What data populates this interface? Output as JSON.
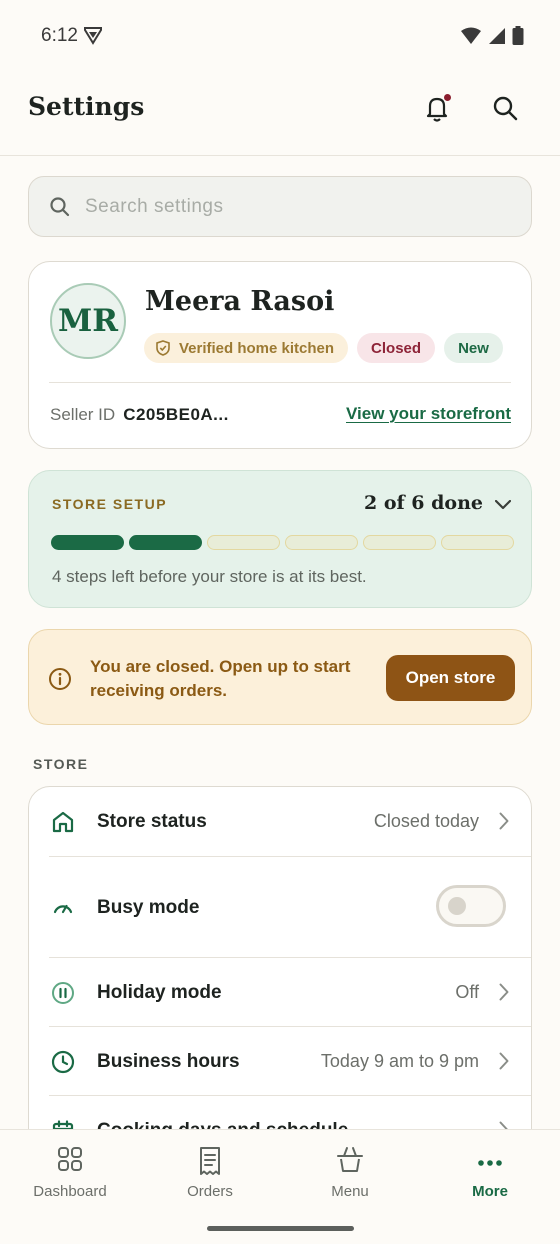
{
  "status_bar": {
    "time": "6:12"
  },
  "app_bar": {
    "title": "Settings"
  },
  "search": {
    "placeholder": "Search settings",
    "value": ""
  },
  "profile": {
    "initials": "MR",
    "name": "Meera Rasoi",
    "badges": [
      "Verified home kitchen",
      "Closed",
      "New"
    ],
    "seller_id_label": "Seller ID",
    "seller_id_value": "C205BE0A...",
    "storefront_link": "View your storefront"
  },
  "setup": {
    "label": "STORE SETUP",
    "progress_text": "2 of 6 done",
    "steps_done": 2,
    "steps_total": 6,
    "hint": "4 steps left before your store is at its best."
  },
  "alert": {
    "message": "You are closed. Open up to start receiving orders.",
    "button": "Open store"
  },
  "store_section": {
    "label": "STORE",
    "rows": [
      {
        "label": "Store status",
        "value": "Closed today",
        "icon": "home-icon"
      },
      {
        "label": "Busy mode",
        "value": "",
        "icon": "gauge-icon",
        "toggle_on": false
      },
      {
        "label": "Holiday mode",
        "value": "Off",
        "icon": "pause-icon"
      },
      {
        "label": "Business hours",
        "value": "Today 9 am to 9 pm",
        "icon": "clock-icon"
      },
      {
        "label": "Cooking days and schedule",
        "value": "",
        "icon": "calendar-icon"
      }
    ]
  },
  "bottom_nav": {
    "items": [
      {
        "label": "Dashboard",
        "icon": "dashboard-icon"
      },
      {
        "label": "Orders",
        "icon": "receipt-icon"
      },
      {
        "label": "Menu",
        "icon": "basket-icon"
      },
      {
        "label": "More",
        "icon": "more-icon",
        "active": true
      }
    ]
  },
  "colors": {
    "brand_green": "#1A6A45",
    "closed_red": "#8E2438",
    "warning_brown": "#8E5415",
    "background": "#FDFBF7"
  }
}
